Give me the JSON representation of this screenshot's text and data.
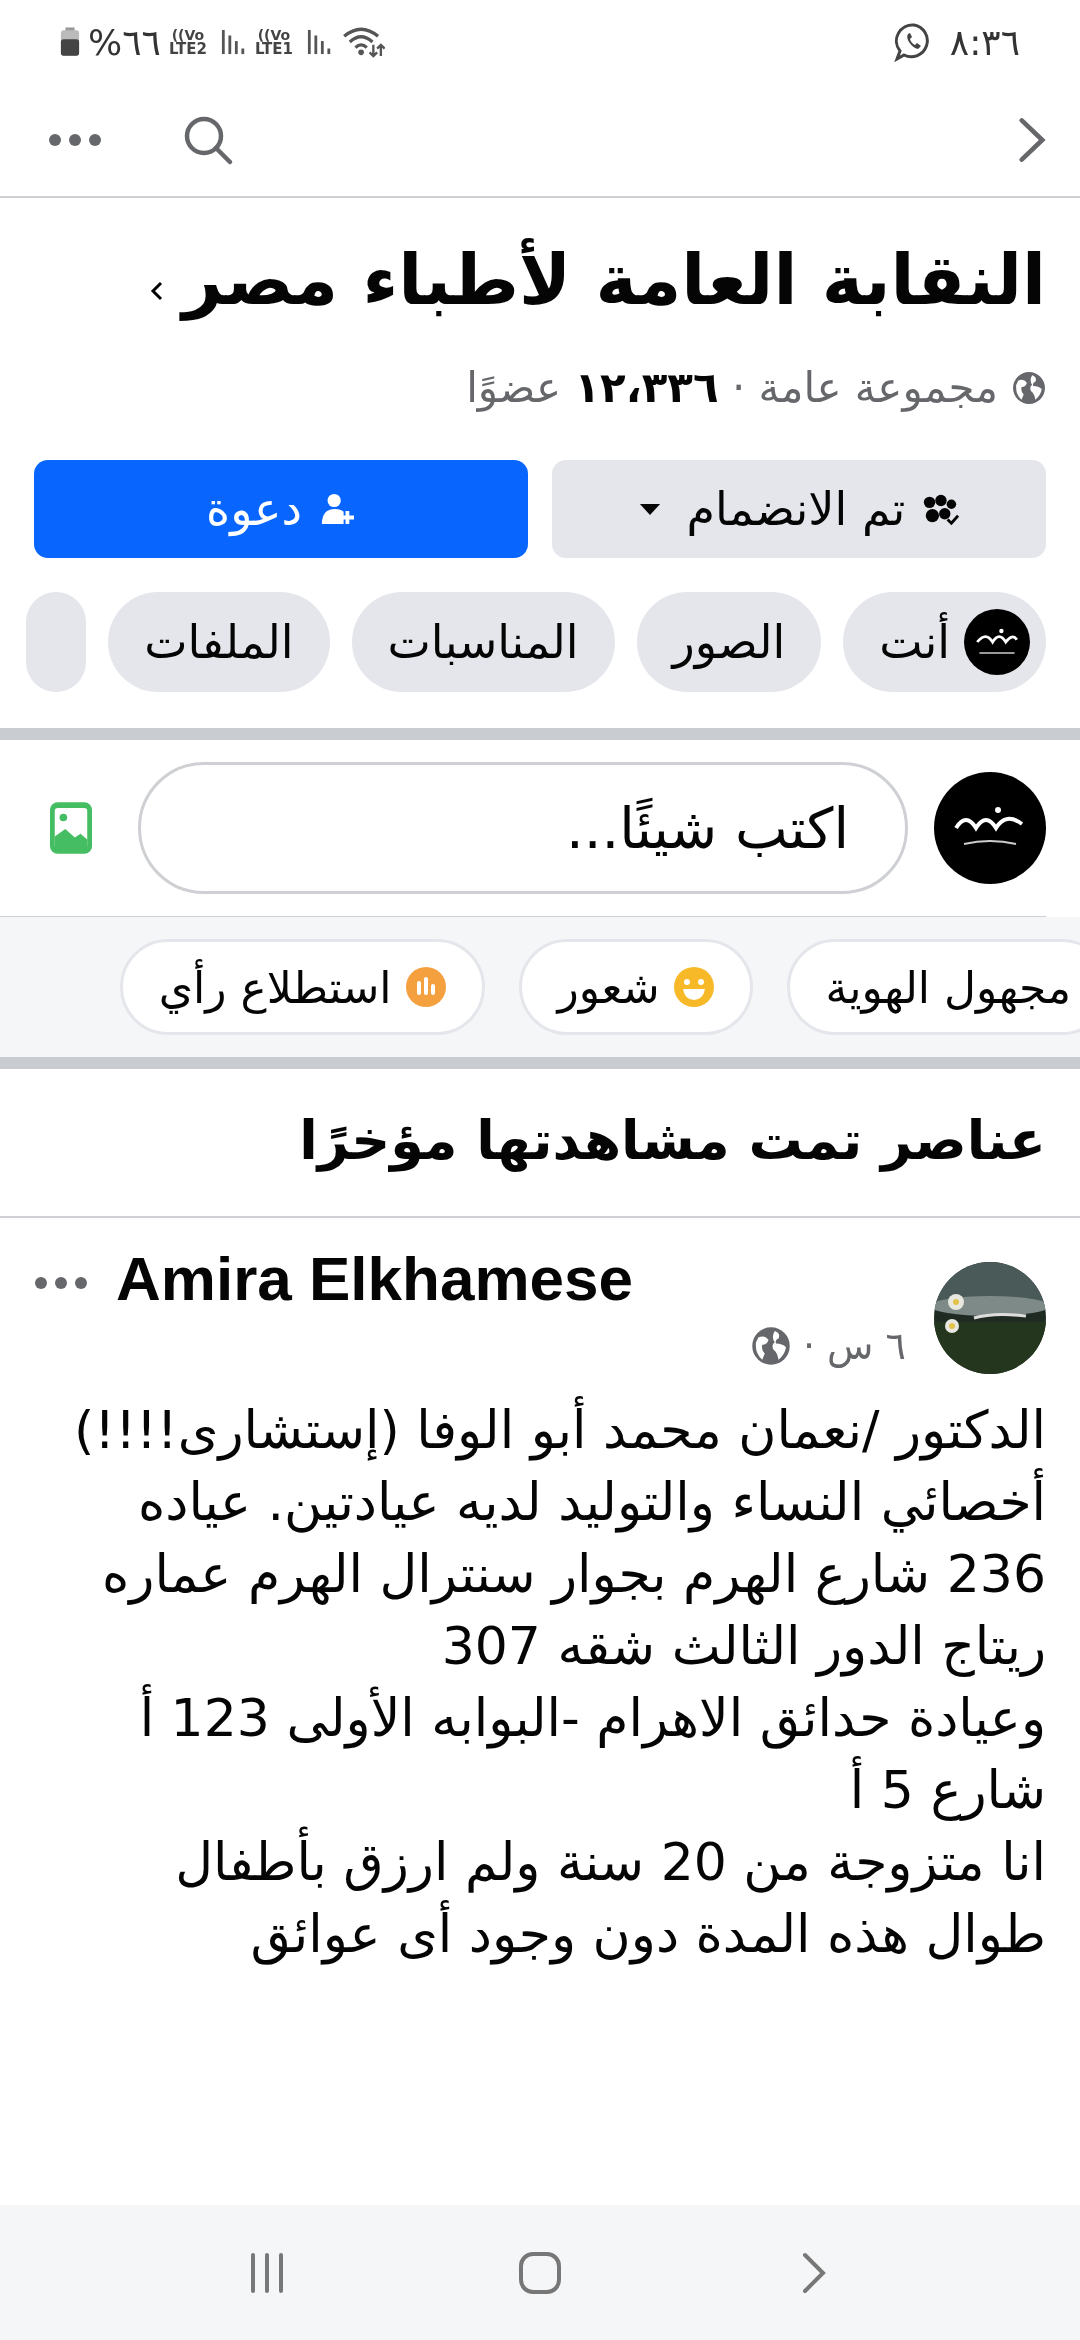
{
  "status_bar": {
    "time": "٨:٣٦",
    "battery": "%٦٦",
    "sims": [
      {
        "volte": "Vo))",
        "network": "LTE1"
      },
      {
        "volte": "Vo))",
        "network": "LTE2"
      }
    ]
  },
  "group": {
    "title": "النقابة العامة لأطباء مصر",
    "meta": "مجموعة عامة · **١٢،٣٣٦** عضوًا"
  },
  "actions": [
    {
      "label": "تم الانضمام",
      "kind": "joined"
    },
    {
      "label": "دعوة",
      "kind": "invite"
    }
  ],
  "tabs": [
    {
      "label": "أنت",
      "kind": "avatar"
    },
    {
      "label": "الصور",
      "kind": "plain"
    },
    {
      "label": "المناسبات",
      "kind": "plain"
    },
    {
      "label": "الملفات",
      "kind": "plain"
    }
  ],
  "composer": {
    "placeholder": "اكتب شيئًا..."
  },
  "chips": [
    {
      "label": "مجهول الهوية",
      "kind": "anonymous"
    },
    {
      "label": "شعور",
      "kind": "feeling"
    },
    {
      "label": "استطلاع رأي",
      "kind": "poll"
    }
  ],
  "section_heading": "عناصر تمت مشاهدتها مؤخرًا",
  "post": {
    "author": "Amira Elkhamese",
    "time": "٦ س ·",
    "text": "الدكتور /نعمان محمد أبو الوفا (إستشارى!!!!)\nأخصائي النساء والتوليد لديه عيادتين. عياده\n236 شارع الهرم بجوار سنترال الهرم عماره\nريتاج الدور الثالث شقه 307\nوعيادة حدائق الاهرام -البوابه الأولى 123 أ\nشارع 5 أ\nانا متزوجة من 20 سنة ولم ارزق بأطفال\nطوال هذه المدة دون وجود أى عوائق"
  }
}
